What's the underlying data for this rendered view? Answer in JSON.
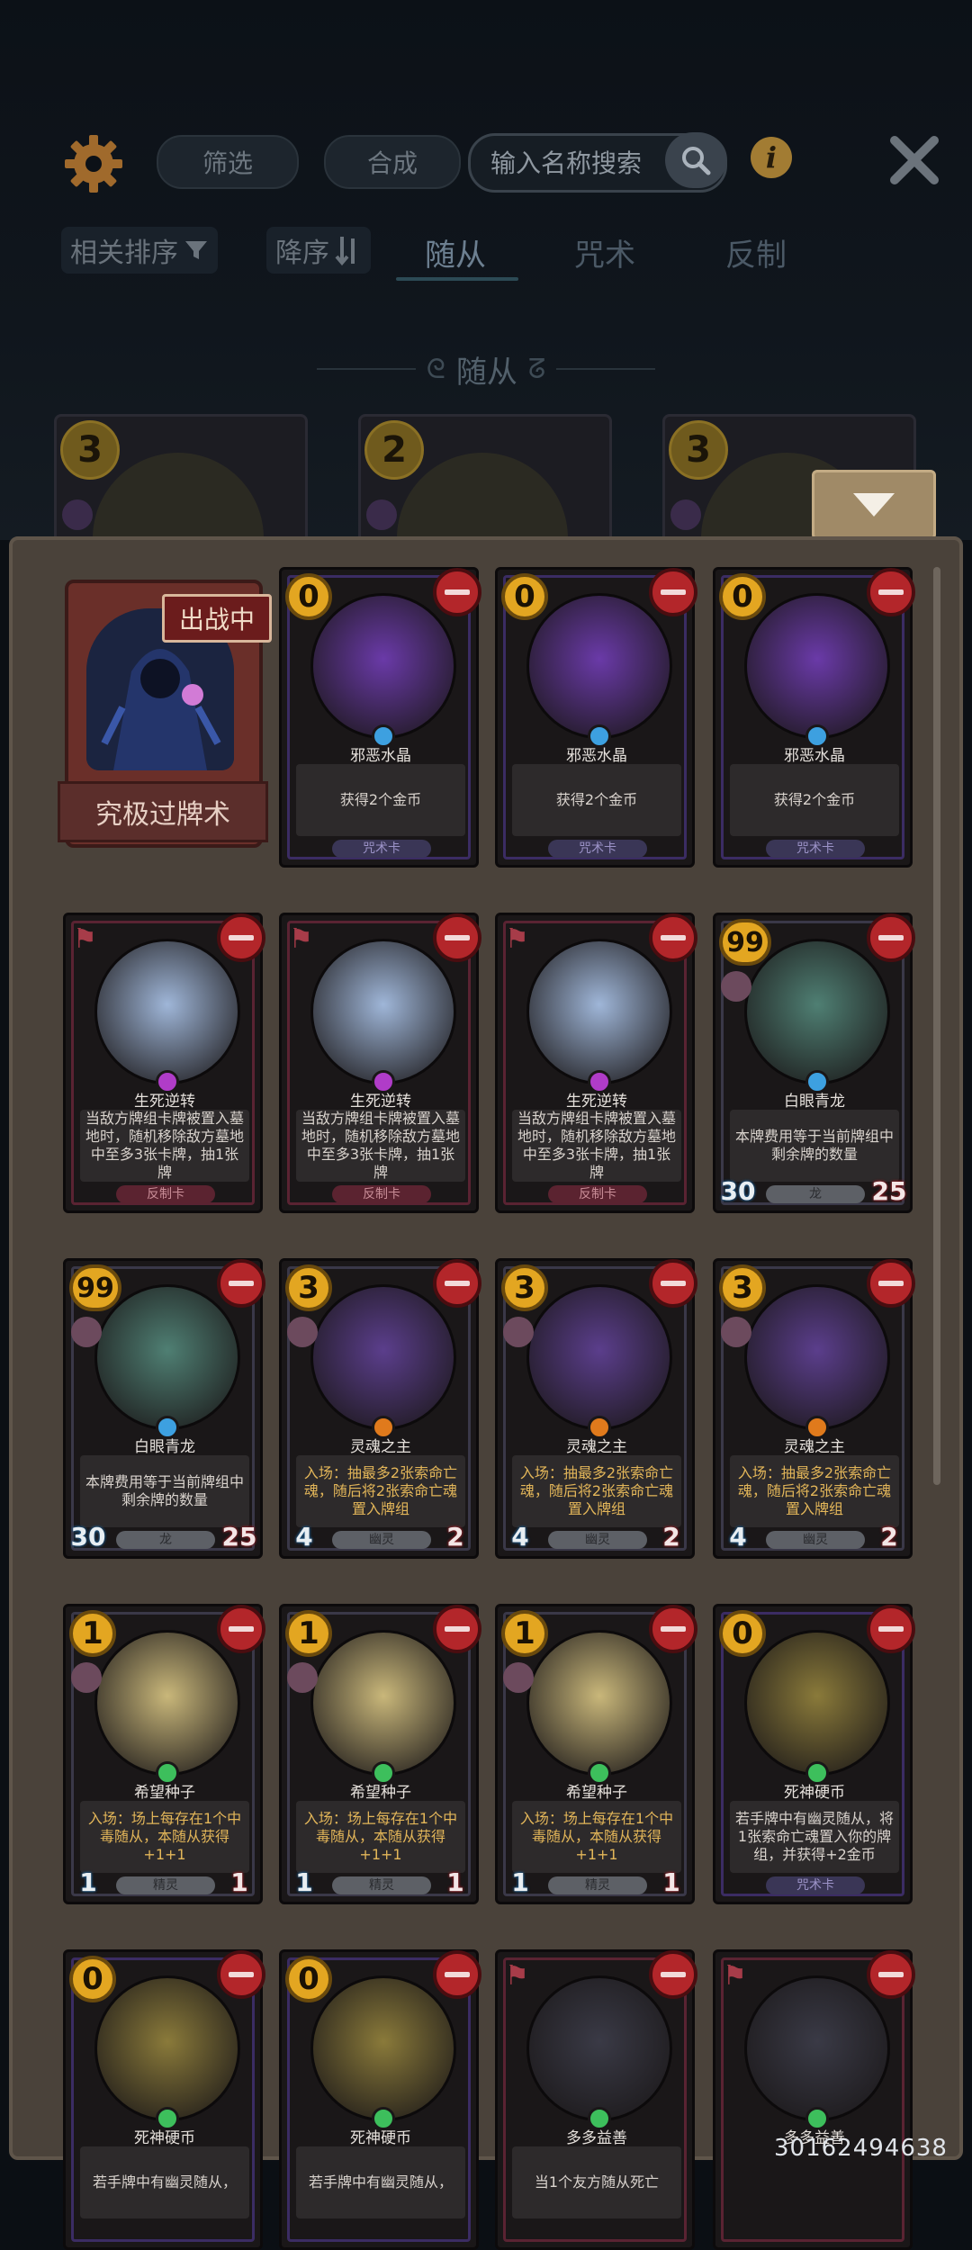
{
  "toolbar": {
    "filter_label": "筛选",
    "craft_label": "合成",
    "search_placeholder": "输入名称搜索"
  },
  "sort": {
    "relevance_label": "相关排序",
    "order_label": "降序"
  },
  "tabs": [
    {
      "label": "随从",
      "active": true
    },
    {
      "label": "咒术",
      "active": false
    },
    {
      "label": "反制",
      "active": false
    }
  ],
  "section_title": "随从",
  "collection_preview": [
    {
      "cost": "3"
    },
    {
      "cost": "2"
    },
    {
      "cost": "3"
    }
  ],
  "hero": {
    "status": "出战中",
    "name": "究极过牌术"
  },
  "cards": [
    {
      "name": "邪恶水晶",
      "cost": "0",
      "desc": "获得2个金币",
      "type": "咒术卡",
      "kind": "spell",
      "gem": "#3da0e0",
      "art": "#6a3aa8"
    },
    {
      "name": "邪恶水晶",
      "cost": "0",
      "desc": "获得2个金币",
      "type": "咒术卡",
      "kind": "spell",
      "gem": "#3da0e0",
      "art": "#6a3aa8"
    },
    {
      "name": "邪恶水晶",
      "cost": "0",
      "desc": "获得2个金币",
      "type": "咒术卡",
      "kind": "spell",
      "gem": "#3da0e0",
      "art": "#6a3aa8"
    },
    {
      "name": "生死逆转",
      "cost": "",
      "desc": "当敌方牌组卡牌被置入墓地时，随机移除敌方墓地中至多3张卡牌，抽1张牌",
      "type": "反制卡",
      "kind": "counter",
      "gem": "#b03cc8",
      "art": "#9fb6d8"
    },
    {
      "name": "生死逆转",
      "cost": "",
      "desc": "当敌方牌组卡牌被置入墓地时，随机移除敌方墓地中至多3张卡牌，抽1张牌",
      "type": "反制卡",
      "kind": "counter",
      "gem": "#b03cc8",
      "art": "#9fb6d8"
    },
    {
      "name": "生死逆转",
      "cost": "",
      "desc": "当敌方牌组卡牌被置入墓地时，随机移除敌方墓地中至多3张卡牌，抽1张牌",
      "type": "反制卡",
      "kind": "counter",
      "gem": "#b03cc8",
      "art": "#9fb6d8"
    },
    {
      "name": "白眼青龙",
      "cost": "99",
      "desc": "本牌费用等于当前牌组中剩余牌的数量",
      "type": "龙",
      "kind": "minion",
      "gem": "#3da0e0",
      "art": "#4f7f73",
      "atk": "30",
      "hp": "25"
    },
    {
      "name": "白眼青龙",
      "cost": "99",
      "desc": "本牌费用等于当前牌组中剩余牌的数量",
      "type": "龙",
      "kind": "minion",
      "gem": "#3da0e0",
      "art": "#4f7f73",
      "atk": "30",
      "hp": "25"
    },
    {
      "name": "灵魂之主",
      "cost": "3",
      "desc": "入场：抽最多2张索命亡魂，随后将2张索命亡魂置入牌组",
      "type": "幽灵",
      "kind": "minion",
      "gem": "#e07a1c",
      "art": "#5b3e8c",
      "atk": "4",
      "hp": "2",
      "gold": true
    },
    {
      "name": "灵魂之主",
      "cost": "3",
      "desc": "入场：抽最多2张索命亡魂，随后将2张索命亡魂置入牌组",
      "type": "幽灵",
      "kind": "minion",
      "gem": "#e07a1c",
      "art": "#5b3e8c",
      "atk": "4",
      "hp": "2",
      "gold": true
    },
    {
      "name": "灵魂之主",
      "cost": "3",
      "desc": "入场：抽最多2张索命亡魂，随后将2张索命亡魂置入牌组",
      "type": "幽灵",
      "kind": "minion",
      "gem": "#e07a1c",
      "art": "#5b3e8c",
      "atk": "4",
      "hp": "2",
      "gold": true
    },
    {
      "name": "希望种子",
      "cost": "1",
      "desc": "入场：场上每存在1个中毒随从，本随从获得+1+1",
      "type": "精灵",
      "kind": "minion",
      "gem": "#3dbf5c",
      "art": "#c9b77a",
      "atk": "1",
      "hp": "1",
      "gold": true
    },
    {
      "name": "希望种子",
      "cost": "1",
      "desc": "入场：场上每存在1个中毒随从，本随从获得+1+1",
      "type": "精灵",
      "kind": "minion",
      "gem": "#3dbf5c",
      "art": "#c9b77a",
      "atk": "1",
      "hp": "1",
      "gold": true
    },
    {
      "name": "希望种子",
      "cost": "1",
      "desc": "入场：场上每存在1个中毒随从，本随从获得+1+1",
      "type": "精灵",
      "kind": "minion",
      "gem": "#3dbf5c",
      "art": "#c9b77a",
      "atk": "1",
      "hp": "1",
      "gold": true
    },
    {
      "name": "死神硬币",
      "cost": "0",
      "desc": "若手牌中有幽灵随从，将1张索命亡魂置入你的牌组，并获得+2金币",
      "type": "咒术卡",
      "kind": "spell",
      "gem": "#3dbf5c",
      "art": "#8a7a3a"
    },
    {
      "name": "死神硬币",
      "cost": "0",
      "desc": "若手牌中有幽灵随从，",
      "type": "",
      "kind": "spell",
      "gem": "#3dbf5c",
      "art": "#8a7a3a"
    },
    {
      "name": "死神硬币",
      "cost": "0",
      "desc": "若手牌中有幽灵随从，",
      "type": "",
      "kind": "spell",
      "gem": "#3dbf5c",
      "art": "#8a7a3a"
    },
    {
      "name": "多多益善",
      "cost": "",
      "desc": "当1个友方随从死亡",
      "type": "",
      "kind": "counter",
      "gem": "#3dbf5c",
      "art": "#3a3a46"
    },
    {
      "name": "多多益善",
      "cost": "",
      "desc": "",
      "type": "",
      "kind": "counter",
      "gem": "#3dbf5c",
      "art": "#3a3a46"
    }
  ],
  "watermark": "30162494638"
}
